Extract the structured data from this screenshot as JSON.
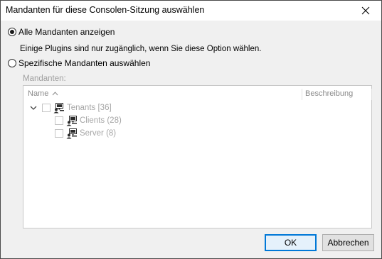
{
  "dialog": {
    "title": "Mandanten für diese Consolen-Sitzung auswählen"
  },
  "options": {
    "all_label": "Alle Mandanten anzeigen",
    "all_selected": true,
    "hint": "Einige Plugins sind nur zugänglich, wenn Sie diese Option wählen.",
    "specific_label": "Spezifische Mandanten auswählen",
    "specific_selected": false
  },
  "tenants": {
    "group_label": "Mandanten:",
    "columns": {
      "name": "Name",
      "description": "Beschreibung"
    },
    "tree": [
      {
        "label": "Tenants [36]",
        "level": 0,
        "expanded": true,
        "checked": false,
        "icon": "tenant-group-icon"
      },
      {
        "label": "Clients (28)",
        "level": 1,
        "checked": false,
        "icon": "tenant-computer-icon"
      },
      {
        "label": "Server (8)",
        "level": 1,
        "checked": false,
        "icon": "tenant-computer-icon"
      }
    ]
  },
  "buttons": {
    "ok": "OK",
    "cancel": "Abbrechen"
  },
  "colors": {
    "accent": "#0078d7",
    "disabled_text": "#a6a6a6"
  }
}
